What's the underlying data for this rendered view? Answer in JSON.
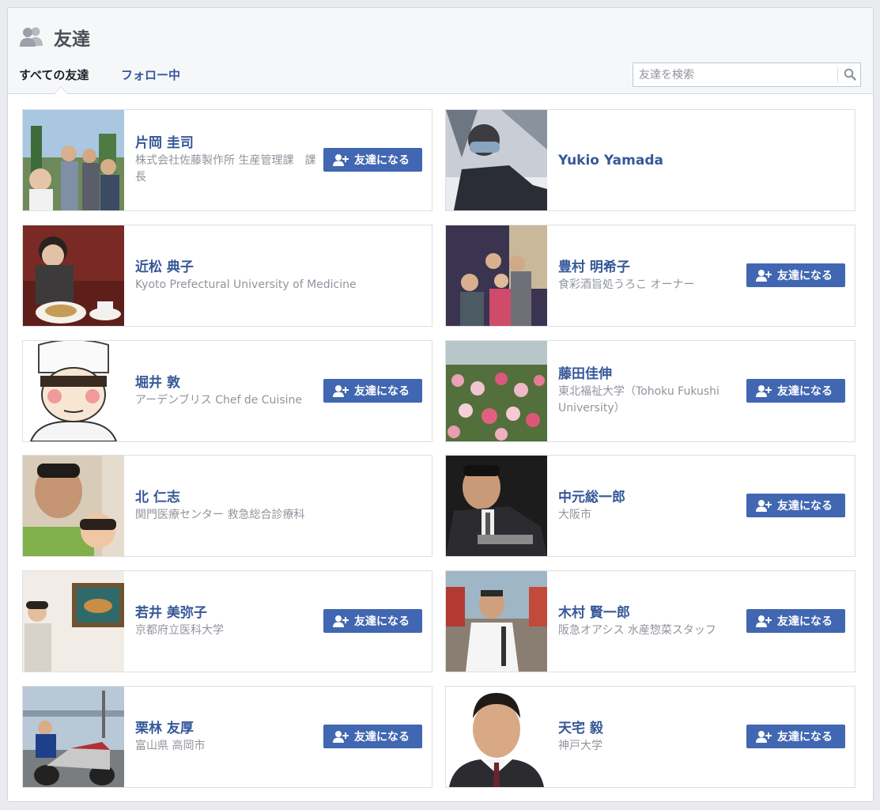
{
  "header": {
    "title": "友達",
    "tabs": [
      "すべての友達",
      "フォロー中"
    ],
    "search_placeholder": "友達を検索"
  },
  "add_label": "友達になる",
  "friends": [
    {
      "name": "片岡 圭司",
      "sub": "株式会社佐藤製作所 生産管理課　課長",
      "button": true
    },
    {
      "name": "Yukio Yamada",
      "sub": "",
      "button": false
    },
    {
      "name": "近松 典子",
      "sub": "Kyoto Prefectural University of Medicine",
      "button": false
    },
    {
      "name": "豊村 明希子",
      "sub": "食彩酒旨処うろこ オーナー",
      "button": true
    },
    {
      "name": "堀井 敦",
      "sub": "アーデンブリス Chef de Cuisine",
      "button": true
    },
    {
      "name": "藤田佳伸",
      "sub": "東北福祉大学（Tohoku Fukushi University）",
      "button": true
    },
    {
      "name": "北 仁志",
      "sub": "関門医療センター 救急総合診療科",
      "button": false
    },
    {
      "name": "中元総一郎",
      "sub": "大阪市",
      "button": true
    },
    {
      "name": "若井 美弥子",
      "sub": "京都府立医科大学",
      "button": true
    },
    {
      "name": "木村 賢一郎",
      "sub": "阪急オアシス 水産惣菜スタッフ",
      "button": true
    },
    {
      "name": "栗林 友厚",
      "sub": "富山県 高岡市",
      "button": true
    },
    {
      "name": "天宅 毅",
      "sub": "神戸大学",
      "button": true
    }
  ],
  "colors": {
    "link": "#365899",
    "button": "#4267b2",
    "muted": "#90949c"
  }
}
